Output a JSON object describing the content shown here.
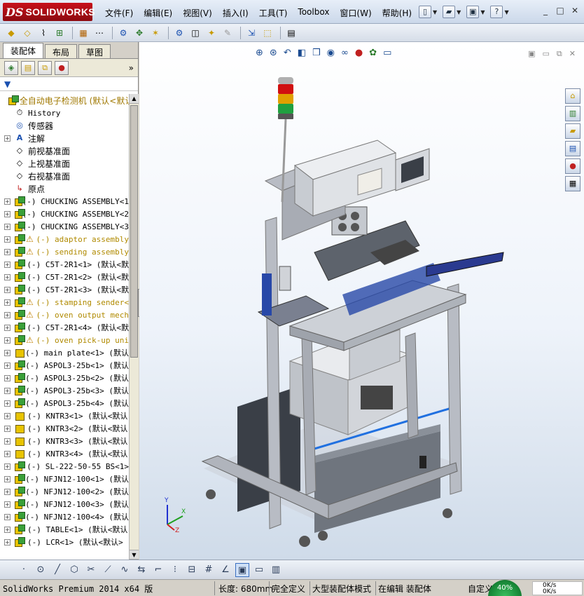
{
  "app": {
    "logo_ds": "DS",
    "logo_name": "SOLIDWORKS"
  },
  "menus": [
    "文件(F)",
    "编辑(E)",
    "视图(V)",
    "插入(I)",
    "工具(T)",
    "Toolbox",
    "窗口(W)",
    "帮助(H)"
  ],
  "window_controls": [
    "_",
    "□",
    "✕"
  ],
  "feature_manager": {
    "tabs": [
      "装配体",
      "布局",
      "草图"
    ],
    "active_tab": 0,
    "more": "»",
    "filter_icon": "funnel-icon",
    "tree": [
      {
        "label": "全自动电子检测机  (默认<默认",
        "type": "root",
        "warn": true,
        "expand": false
      },
      {
        "label": "History",
        "type": "history",
        "warn": false,
        "expand": false
      },
      {
        "label": "传感器",
        "type": "sensor",
        "warn": false,
        "expand": false
      },
      {
        "label": "注解",
        "type": "annotation",
        "warn": false,
        "expand": true
      },
      {
        "label": "前视基准面",
        "type": "plane",
        "warn": false,
        "expand": false
      },
      {
        "label": "上视基准面",
        "type": "plane",
        "warn": false,
        "expand": false
      },
      {
        "label": "右视基准面",
        "type": "plane",
        "warn": false,
        "expand": false
      },
      {
        "label": "原点",
        "type": "origin",
        "warn": false,
        "expand": false
      },
      {
        "label": "(-) CHUCKING ASSEMBLY<1",
        "type": "asm",
        "warn": false,
        "expand": true
      },
      {
        "label": "(-) CHUCKING ASSEMBLY<2",
        "type": "asm",
        "warn": false,
        "expand": true
      },
      {
        "label": "(-) CHUCKING ASSEMBLY<3",
        "type": "asm",
        "warn": false,
        "expand": true
      },
      {
        "label": "(-) adaptor assembly",
        "type": "asm",
        "warn": true,
        "expand": true
      },
      {
        "label": "(-) sending assembly",
        "type": "asm",
        "warn": true,
        "expand": true
      },
      {
        "label": "(-) C5T-2R1<1> (默认<默",
        "type": "asm",
        "warn": false,
        "expand": true
      },
      {
        "label": "(-) C5T-2R1<2> (默认<默",
        "type": "asm",
        "warn": false,
        "expand": true
      },
      {
        "label": "(-) C5T-2R1<3> (默认<默",
        "type": "asm",
        "warn": false,
        "expand": true
      },
      {
        "label": "(-) stamping sender<",
        "type": "asm",
        "warn": true,
        "expand": true
      },
      {
        "label": "(-) oven output mech",
        "type": "asm",
        "warn": true,
        "expand": true
      },
      {
        "label": "(-) C5T-2R1<4> (默认<默",
        "type": "asm",
        "warn": false,
        "expand": true
      },
      {
        "label": "(-) oven pick-up uni",
        "type": "asm",
        "warn": true,
        "expand": true
      },
      {
        "label": "(-) main plate<1> (默认",
        "type": "prt",
        "warn": false,
        "expand": true
      },
      {
        "label": "(-) ASPOL3-25b<1> (默认",
        "type": "asm",
        "warn": false,
        "expand": true
      },
      {
        "label": "(-) ASPOL3-25b<2> (默认",
        "type": "asm",
        "warn": false,
        "expand": true
      },
      {
        "label": "(-) ASPOL3-25b<3> (默认",
        "type": "asm",
        "warn": false,
        "expand": true
      },
      {
        "label": "(-) ASPOL3-25b<4> (默认",
        "type": "asm",
        "warn": false,
        "expand": true
      },
      {
        "label": "(-) KNTR3<1> (默认<默认",
        "type": "prt",
        "warn": false,
        "expand": true
      },
      {
        "label": "(-) KNTR3<2> (默认<默认",
        "type": "prt",
        "warn": false,
        "expand": true
      },
      {
        "label": "(-) KNTR3<3> (默认<默认",
        "type": "prt",
        "warn": false,
        "expand": true
      },
      {
        "label": "(-) KNTR3<4> (默认<默认",
        "type": "prt",
        "warn": false,
        "expand": true
      },
      {
        "label": "(-) SL-222-50-55 BS<1>",
        "type": "asm",
        "warn": false,
        "expand": true
      },
      {
        "label": "(-) NFJN12-100<1> (默认",
        "type": "asm",
        "warn": false,
        "expand": true
      },
      {
        "label": "(-) NFJN12-100<2> (默认",
        "type": "asm",
        "warn": false,
        "expand": true
      },
      {
        "label": "(-) NFJN12-100<3> (默认",
        "type": "asm",
        "warn": false,
        "expand": true
      },
      {
        "label": "(-) NFJN12-100<4> (默认",
        "type": "asm",
        "warn": false,
        "expand": true
      },
      {
        "label": "(-) TABLE<1> (默认<默认",
        "type": "asm",
        "warn": false,
        "expand": true
      },
      {
        "label": "(-) LCR<1> (默认<默认>",
        "type": "asm",
        "warn": false,
        "expand": true
      }
    ]
  },
  "triad": {
    "x": "X",
    "y": "Y",
    "z": "Z"
  },
  "status": {
    "product": "SolidWorks Premium 2014 x64 版",
    "length": "长度: 680mm",
    "definition": "完全定义",
    "mode": "大型装配体模式",
    "editing": "在编辑 装配体",
    "custom": "自定义",
    "gauge": "40%",
    "net_up": "0K/s",
    "net_down": "0K/s"
  },
  "colors": {
    "accent": "#1a50b0",
    "warn": "#b08a00",
    "frame": "#b8bcc4",
    "light_red": "#d01010",
    "light_amber": "#e0a000",
    "light_green": "#20a040"
  }
}
